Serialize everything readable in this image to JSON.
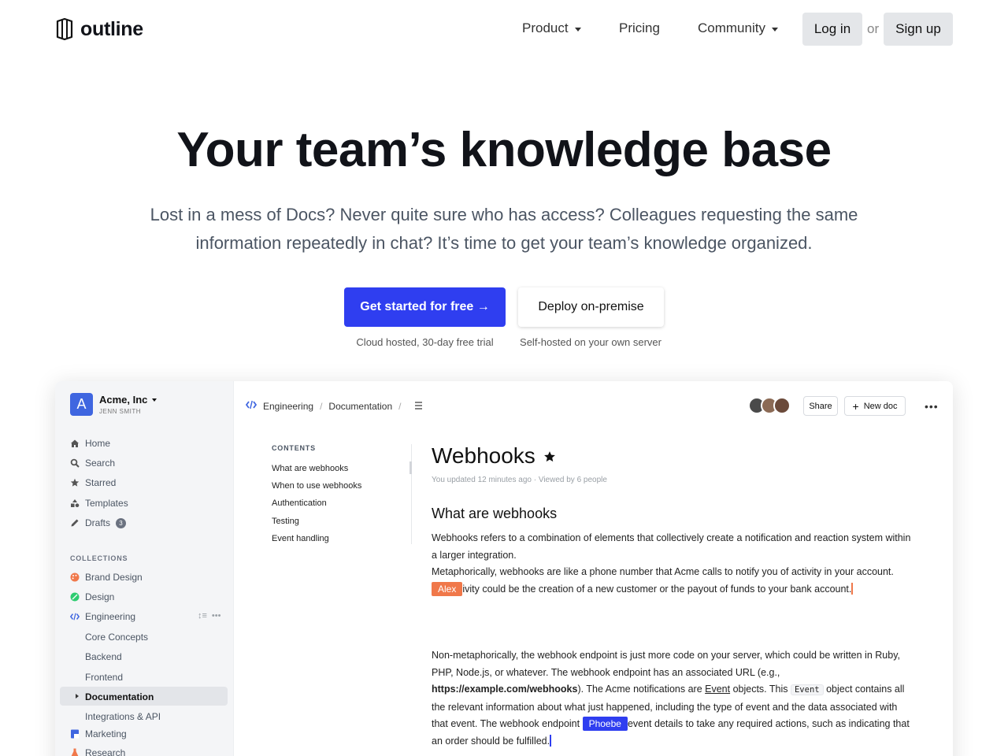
{
  "nav": {
    "logo_text": "outline",
    "links": [
      {
        "label": "Product"
      },
      {
        "label": "Pricing"
      },
      {
        "label": "Community"
      }
    ],
    "login_label": "Log in",
    "or_text": "or",
    "signup_label": "Sign up"
  },
  "hero": {
    "title": "Your team’s knowledge base",
    "subtitle": "Lost in a mess of Docs? Never quite sure who has access? Colleagues requesting the same information repeatedly in chat? It’s time to get your team’s knowledge organized.",
    "cta_primary": "Get started for free →",
    "cta_secondary": "Deploy on-premise",
    "cta_primary_note": "Cloud hosted, 30-day free trial",
    "cta_secondary_note": "Self-hosted on your own server"
  },
  "app": {
    "team": {
      "avatar_letter": "A",
      "name": "Acme, Inc",
      "user": "JENN SMITH"
    },
    "sidebar": {
      "items": [
        {
          "label": "Home",
          "icon": "home-icon"
        },
        {
          "label": "Search",
          "icon": "search-icon"
        },
        {
          "label": "Starred",
          "icon": "star-icon"
        },
        {
          "label": "Templates",
          "icon": "templates-icon"
        },
        {
          "label": "Drafts",
          "icon": "pencil-icon",
          "badge": "3"
        }
      ],
      "collections_header": "COLLECTIONS",
      "collections": [
        {
          "label": "Brand Design",
          "color": "#f0784a"
        },
        {
          "label": "Design",
          "color": "#2ecc71"
        },
        {
          "label": "Engineering",
          "color": "#3f66e0"
        }
      ],
      "engineering_children": [
        "Core Concepts",
        "Backend",
        "Frontend",
        "Documentation",
        "Integrations & API"
      ],
      "more_collections": [
        {
          "label": "Marketing",
          "color": "#3f66e0"
        },
        {
          "label": "Research",
          "color": "#f0784a"
        }
      ]
    },
    "breadcrumb": {
      "collection": "Engineering",
      "document": "Documentation"
    },
    "share_label": "Share",
    "new_doc_label": "New doc",
    "toc": {
      "header": "CONTENTS",
      "items": [
        "What are webhooks",
        "When to use webhooks",
        "Authentication",
        "Testing",
        "Event handling"
      ]
    },
    "doc": {
      "title": "Webhooks",
      "meta": "You updated 12 minutes ago · Viewed by 6 people",
      "h2": "What are webhooks",
      "p1": "Webhooks refers to a combination of elements that collectively create a notification and reaction system within a larger integration.",
      "p2_a": "Metaphorically, webhooks are like a phone number that Acme calls to notify you of activity in your account.",
      "p2_b": "ivity could be the creation of a new customer or the payout of funds to your bank account.",
      "cursor1_name": "Alex",
      "cursor1_color": "#f0784a",
      "p3_a": "Non-metaphorically, the webhook endpoint is just more code on your server, which could be written in Ruby, PHP, Node.js, or whatever. The webhook endpoint has an associated URL (e.g., ",
      "p3_link": "https://example.com/webhooks",
      "p3_b": "). The Acme notifications are ",
      "p3_event": "Event",
      "p3_c": " objects. This ",
      "p3_code": "Event",
      "p3_d": " object contains all the relevant information about what just happened, including the type of event and the data associated with that event. The webhook endpoint ",
      "cursor2_name": "Phoebe",
      "cursor2_color": "#2f3ef0",
      "p3_e": "event details to take any required actions, such as indicating that an order should be fulfilled."
    }
  },
  "colors": {
    "brand": "#2f3ef0",
    "accent_orange": "#f0784a"
  }
}
